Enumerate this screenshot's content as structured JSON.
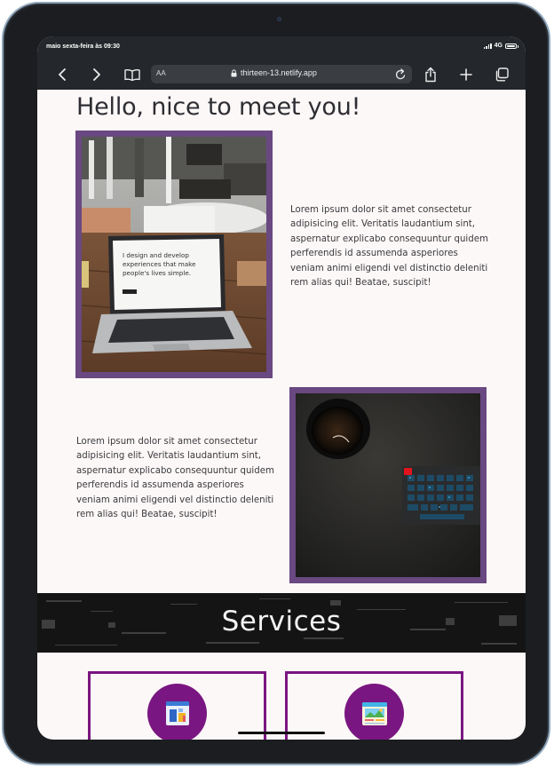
{
  "status_bar": {
    "time": "maio sexta-feira às 09:30",
    "network": "4G"
  },
  "browser": {
    "text_size_label": "AA",
    "url": "thirteen-13.netlify.app",
    "icons": [
      "back-icon",
      "forward-icon",
      "bookmarks-icon",
      "lock-icon",
      "reload-icon",
      "share-icon",
      "new-tab-icon",
      "tabs-icon"
    ]
  },
  "page": {
    "heading": "Hello, nice to meet you!",
    "photo1_caption_lines": [
      "I design and develop",
      "experiences that make",
      "people's lives simple."
    ],
    "paragraph1": "Lorem ipsum dolor sit amet consectetur adipisicing elit. Veritatis laudantium sint, aspernatur explicabo consequuntur quidem perferendis id assumenda asperiores veniam animi eligendi vel distinctio deleniti rem alias qui! Beatae, suscipit!",
    "paragraph2": "Lorem ipsum dolor sit amet consectetur adipisicing elit. Veritatis laudantium sint, aspernatur explicabo consequuntur quidem perferendis id assumenda asperiores veniam animi eligendi vel distinctio deleniti rem alias qui! Beatae, suscipit!",
    "services_title": "Services",
    "service_icons": [
      "design-icon",
      "landscape-icon"
    ]
  },
  "colors": {
    "frame_purple": "#6a4881",
    "service_purple": "#7a1681",
    "page_background": "#fcf8f7",
    "browser_chrome": "#24272b"
  }
}
